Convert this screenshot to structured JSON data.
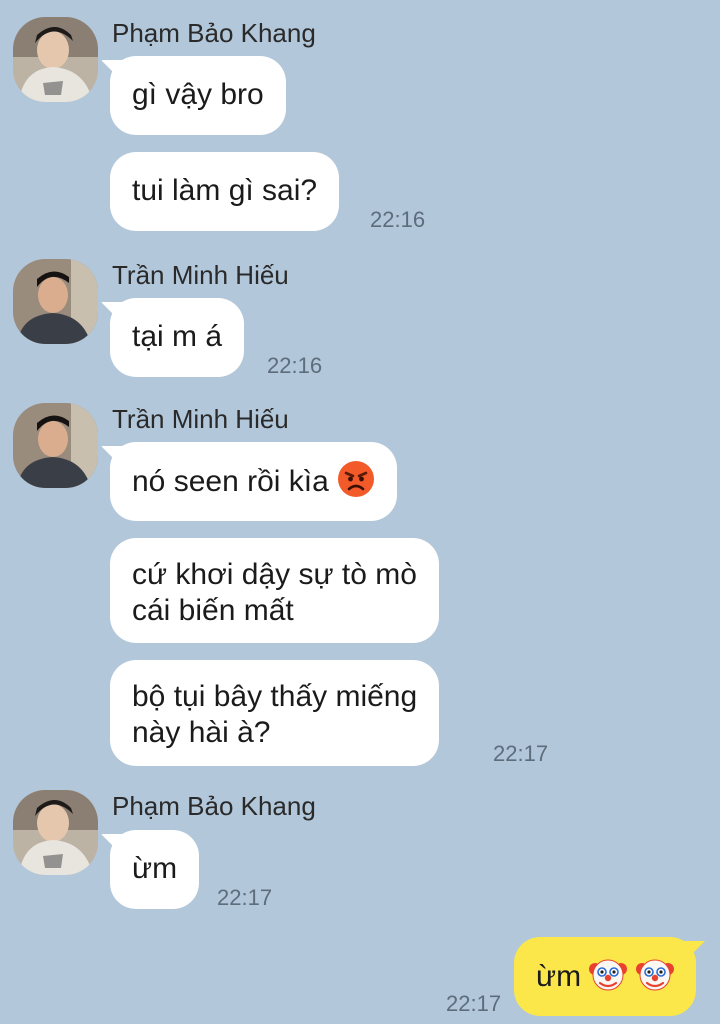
{
  "colors": {
    "background": "#b2c7da",
    "incoming_bubble": "#ffffff",
    "outgoing_bubble": "#fbe74a",
    "timestamp": "#5d6d7c"
  },
  "messages": {
    "group1": {
      "sender": "Phạm Bảo Khang",
      "msg1": "gì vậy bro",
      "msg2": "tui làm gì sai?",
      "time": "22:16"
    },
    "group2": {
      "sender": "Trần Minh Hiếu",
      "msg1": "tại m á",
      "time": "22:16"
    },
    "group3": {
      "sender": "Trần Minh Hiếu",
      "msg1": "nó seen rồi kìa",
      "msg1_emoji": "angry-face-icon",
      "msg2_line1": "cứ khơi dậy sự tò mò",
      "msg2_line2": "cái biến mất",
      "msg3_line1": "bộ tụi bây thấy miếng",
      "msg3_line2": "này hài à?",
      "time": "22:17"
    },
    "group4": {
      "sender": "Phạm Bảo Khang",
      "msg1": "ừm",
      "time": "22:17"
    },
    "outgoing": {
      "msg1": "ừm",
      "msg1_emoji": "clown-face-icon",
      "time": "22:17"
    }
  }
}
